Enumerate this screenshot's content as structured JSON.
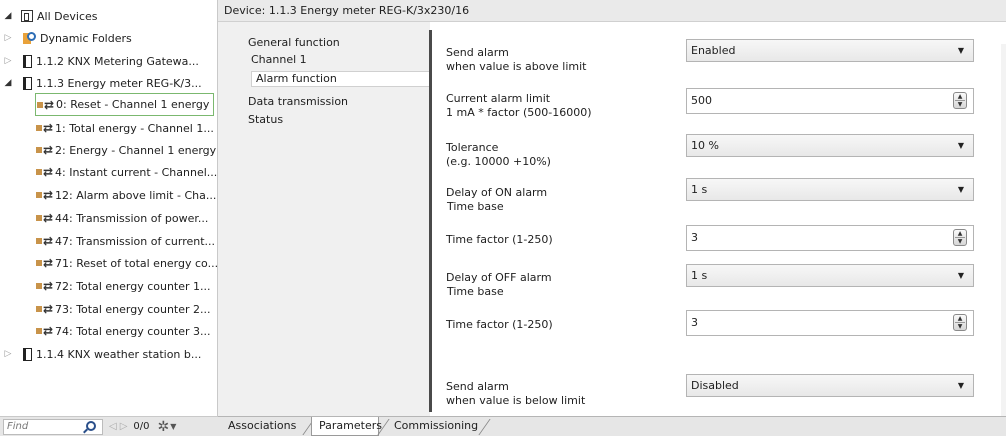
{
  "tree": {
    "root_label": "All Devices",
    "items": [
      {
        "label": "Dynamic Folders"
      },
      {
        "label": "1.1.2  KNX Metering Gatewa..."
      },
      {
        "label": "1.1.3  Energy meter REG-K/3..."
      },
      {
        "label": "0: Reset - Channel 1 energy"
      },
      {
        "label": "1: Total energy - Channel 1..."
      },
      {
        "label": "2: Energy - Channel 1 energy"
      },
      {
        "label": "4: Instant current - Channel..."
      },
      {
        "label": "12: Alarm above limit - Cha..."
      },
      {
        "label": "44: Transmission of power..."
      },
      {
        "label": "47: Transmission of current..."
      },
      {
        "label": "71: Reset of total energy co..."
      },
      {
        "label": "72: Total energy counter 1..."
      },
      {
        "label": "73: Total energy counter 2..."
      },
      {
        "label": "74: Total energy counter 3..."
      },
      {
        "label": "1.1.4  KNX weather station b..."
      }
    ]
  },
  "search": {
    "placeholder": "Find",
    "count": "0/0"
  },
  "header": {
    "title": "Device: 1.1.3  Energy meter REG-K/3x230/16"
  },
  "param_nav": {
    "items": [
      {
        "label": "General function"
      },
      {
        "label": "Channel 1"
      },
      {
        "label": "Alarm function"
      },
      {
        "label": "Data transmission"
      },
      {
        "label": "Status"
      }
    ],
    "active": "Alarm function"
  },
  "params": [
    {
      "label1": "Send alarm",
      "label2": "when value is above limit",
      "value": "Enabled",
      "type": "combo"
    },
    {
      "label1": "Current alarm limit",
      "label2": "1 mA * factor (500-16000)",
      "value": "500",
      "type": "spin"
    },
    {
      "label1": "Tolerance",
      "label2": "(e.g. 10000 +10%)",
      "value": "10 %",
      "type": "combo"
    },
    {
      "label1": "Delay of ON alarm",
      "label2": "Time base",
      "value": "1 s",
      "type": "combo"
    },
    {
      "label1": "Time factor (1-250)",
      "label2": "",
      "value": "3",
      "type": "spin"
    },
    {
      "label1": "Delay of OFF alarm",
      "label2": "Time base",
      "value": "1 s",
      "type": "combo"
    },
    {
      "label1": "Time factor (1-250)",
      "label2": "",
      "value": "3",
      "type": "spin"
    },
    {
      "label1": "Send alarm",
      "label2": "when value is below limit",
      "value": "Disabled",
      "type": "combo"
    }
  ],
  "tabs": [
    {
      "label": "Associations"
    },
    {
      "label": "Parameters"
    },
    {
      "label": "Commissioning"
    }
  ],
  "active_tab": "Parameters"
}
